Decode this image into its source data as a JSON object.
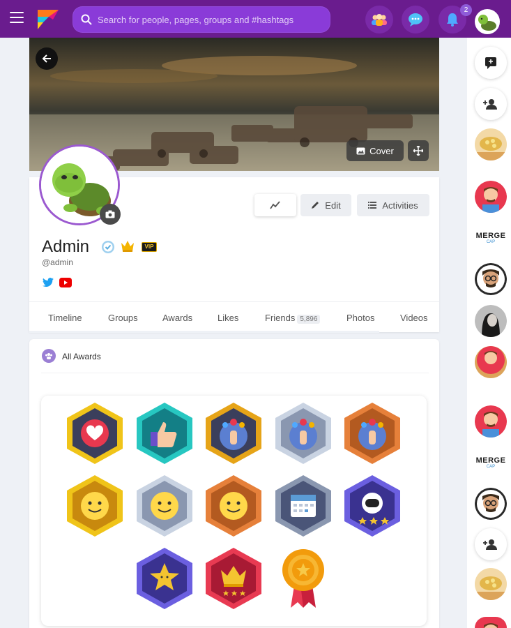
{
  "topbar": {
    "search_placeholder": "Search for people, pages, groups and #hashtags",
    "notification_count": "2"
  },
  "cover": {
    "cover_label": "Cover"
  },
  "profile": {
    "name": "Admin",
    "handle": "@admin",
    "vip_label": "VIP",
    "edit_label": "Edit",
    "activities_label": "Activities"
  },
  "tabs": [
    {
      "label": "Timeline"
    },
    {
      "label": "Groups"
    },
    {
      "label": "Awards"
    },
    {
      "label": "Likes"
    },
    {
      "label": "Friends",
      "count": "5,896"
    },
    {
      "label": "Photos"
    },
    {
      "label": "Videos"
    }
  ],
  "awards": {
    "title": "All Awards",
    "items": [
      {
        "icon": "heart-badge",
        "color": "#f0c419"
      },
      {
        "icon": "thumbs-up-badge",
        "color": "#27c7c1"
      },
      {
        "icon": "reactions-gold-badge",
        "color": "#e6a418"
      },
      {
        "icon": "reactions-silver-badge",
        "color": "#c9d3e2"
      },
      {
        "icon": "reactions-bronze-badge",
        "color": "#e6803a"
      },
      {
        "icon": "smiley-gold-badge",
        "color": "#f0c419"
      },
      {
        "icon": "smiley-silver-badge",
        "color": "#c9d3e2"
      },
      {
        "icon": "smiley-bronze-badge",
        "color": "#e6803a"
      },
      {
        "icon": "calendar-badge",
        "color": "#4a5578"
      },
      {
        "icon": "astronaut-badge",
        "color": "#5b4fc9"
      },
      {
        "icon": "star-badge",
        "color": "#5b4fc9"
      },
      {
        "icon": "crown-badge",
        "color": "#c8203c"
      },
      {
        "icon": "medal-badge",
        "color": "#f29b0c"
      }
    ]
  },
  "sidebar": {
    "merge_label": "MERGE",
    "merge_sub": "CAP"
  }
}
